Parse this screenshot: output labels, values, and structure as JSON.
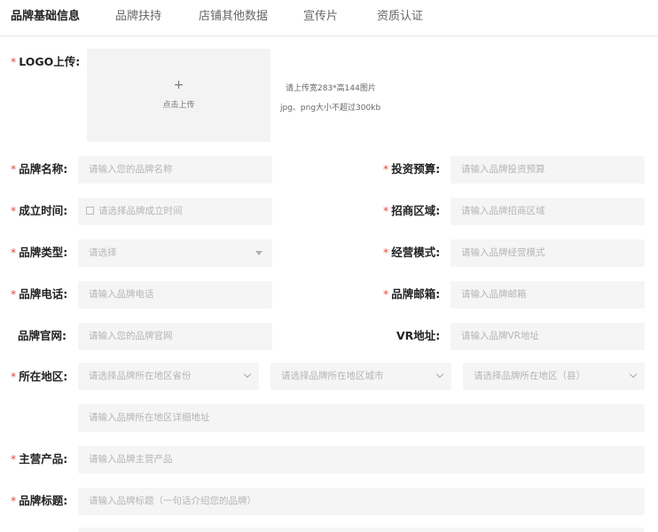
{
  "tabs": [
    "品牌基础信息",
    "品牌扶持",
    "店铺其他数据",
    "宣传片",
    "资质认证"
  ],
  "required_mark": "*",
  "logo": {
    "label": "LOGO上传:",
    "plus": "+",
    "upload_text": "点击上传",
    "hint_size": "请上传宽283*高144图片",
    "hint_format": "jpg、png大小不超过300kb"
  },
  "fields": {
    "brand_name": {
      "label": "品牌名称:",
      "placeholder": "请输入您的品牌名称"
    },
    "investment_budget": {
      "label": "投资预算:",
      "placeholder": "请输入品牌投资预算"
    },
    "founded_time": {
      "label": "成立时间:",
      "placeholder": "请选择品牌成立时间"
    },
    "region": {
      "label": "招商区域:",
      "placeholder": "请输入品牌招商区域"
    },
    "brand_type": {
      "label": "品牌类型:",
      "placeholder": "请选择"
    },
    "business_mode": {
      "label": "经营模式:",
      "placeholder": "请输入品牌经营模式"
    },
    "phone": {
      "label": "品牌电话:",
      "placeholder": "请输入品牌电话"
    },
    "email": {
      "label": "品牌邮箱:",
      "placeholder": "请输入品牌邮箱"
    },
    "website": {
      "label": "品牌官网:",
      "placeholder": "请输入您的品牌官网"
    },
    "vr": {
      "label": "VR地址:",
      "placeholder": "请输入品牌VR地址"
    },
    "location": {
      "label": "所在地区:",
      "province": "请选择品牌所在地区省份",
      "city": "请选择品牌所在地区城市",
      "county": "请选择品牌所在地区（县）",
      "detail": "请输入品牌所在地区详细地址"
    },
    "products": {
      "label": "主营产品:",
      "placeholder": "请输入品牌主营产品"
    },
    "title": {
      "label": "品牌标题:",
      "placeholder": "请输入品牌标题（一句话介绍您的品牌）"
    }
  }
}
